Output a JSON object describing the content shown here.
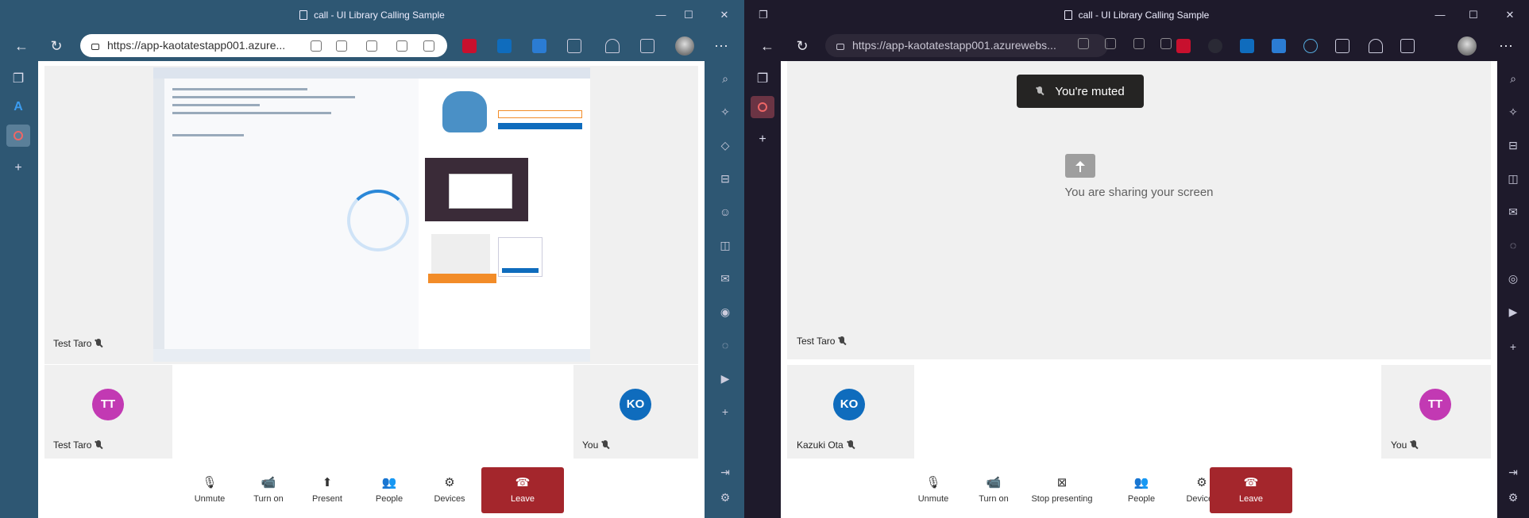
{
  "left_window": {
    "title": "call - UI Library Calling Sample",
    "url": "https://app-kaotatestapp001.azure...",
    "colors": {
      "frame": "#2e5773",
      "accent": "#0f6cbd"
    },
    "stage": {
      "participant_name": "Test Taro"
    },
    "tiles": [
      {
        "initials": "TT",
        "name": "Test Taro",
        "avatar_color": "#c239b3"
      },
      {
        "initials": "KO",
        "name": "You",
        "avatar_color": "#0f6cbd"
      }
    ],
    "controls": [
      {
        "label": "Unmute",
        "icon": "mic-off-icon"
      },
      {
        "label": "Turn on",
        "icon": "camera-off-icon"
      },
      {
        "label": "Present",
        "icon": "present-icon"
      },
      {
        "label": "People",
        "icon": "people-icon"
      },
      {
        "label": "Devices",
        "icon": "gear-icon"
      },
      {
        "label": "Leave",
        "icon": "phone-hangup-icon"
      }
    ]
  },
  "right_window": {
    "title": "call - UI Library Calling Sample",
    "url": "https://app-kaotatestapp001.azurewebs...",
    "colors": {
      "frame": "#1e1a2b",
      "leave": "#a4262c"
    },
    "toast": "You're muted",
    "sharing_message": "You are sharing your screen",
    "stage": {
      "participant_name": "Test Taro"
    },
    "tiles": [
      {
        "initials": "KO",
        "name": "Kazuki Ota",
        "avatar_color": "#0f6cbd"
      },
      {
        "initials": "TT",
        "name": "You",
        "avatar_color": "#c239b3"
      }
    ],
    "controls": [
      {
        "label": "Unmute",
        "icon": "mic-off-icon"
      },
      {
        "label": "Turn on",
        "icon": "camera-off-icon"
      },
      {
        "label": "Stop presenting",
        "icon": "stop-present-icon"
      },
      {
        "label": "People",
        "icon": "people-icon"
      },
      {
        "label": "Devices",
        "icon": "gear-icon"
      },
      {
        "label": "Leave",
        "icon": "phone-hangup-icon"
      }
    ]
  }
}
